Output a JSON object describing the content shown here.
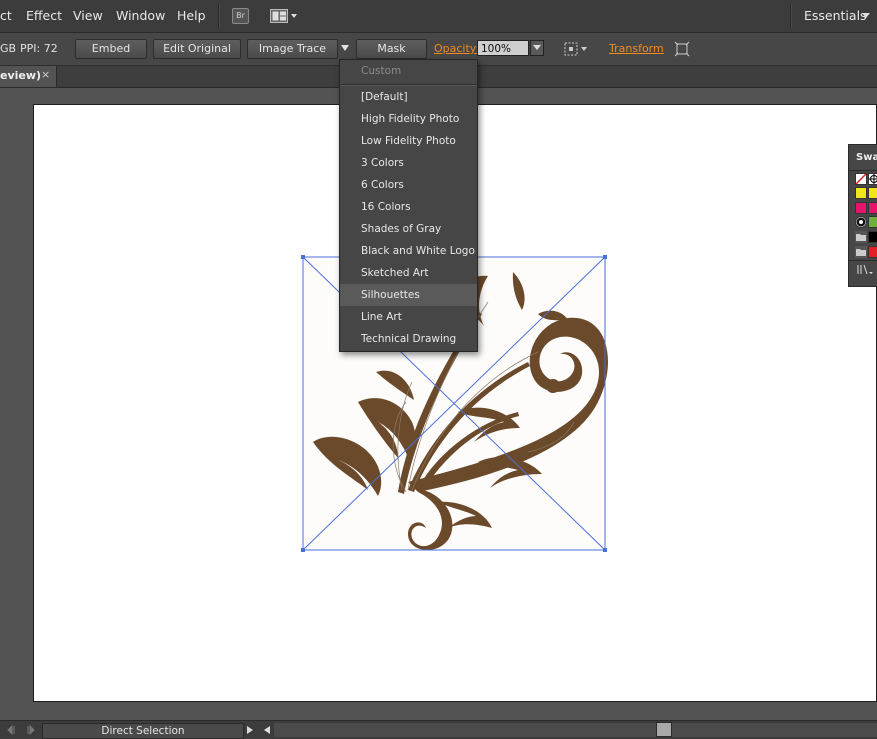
{
  "menubar": {
    "items": [
      "ct",
      "Effect",
      "View",
      "Window",
      "Help"
    ],
    "bridge_label": "Br",
    "workspace_label": "Essentials"
  },
  "controlbar": {
    "color_mode": "GB",
    "ppi": "PPI: 72",
    "embed_label": "Embed",
    "edit_original_label": "Edit Original",
    "image_trace_label": "Image Trace",
    "mask_label": "Mask",
    "opacity_label": "Opacity:",
    "opacity_value": "100%",
    "transform_label": "Transform"
  },
  "document_tab": {
    "title": "eview)",
    "close": "×"
  },
  "trace_presets": {
    "header": "Custom",
    "items": [
      "[Default]",
      "High Fidelity Photo",
      "Low Fidelity Photo",
      "3 Colors",
      "6 Colors",
      "16 Colors",
      "Shades of Gray",
      "Black and White Logo",
      "Sketched Art",
      "Silhouettes",
      "Line Art",
      "Technical Drawing"
    ],
    "highlighted": "Silhouettes"
  },
  "swatches_panel": {
    "title": "Swat",
    "colors": {
      "yellow": "#f2e51a",
      "magenta": "#e6156b",
      "black": "#000000",
      "red": "#e31e24",
      "green": "#6fb03b"
    }
  },
  "statusbar": {
    "tool": "Direct Selection"
  },
  "artwork": {
    "color": "#6b4a2b",
    "selection_color": "#4a6fd9"
  }
}
